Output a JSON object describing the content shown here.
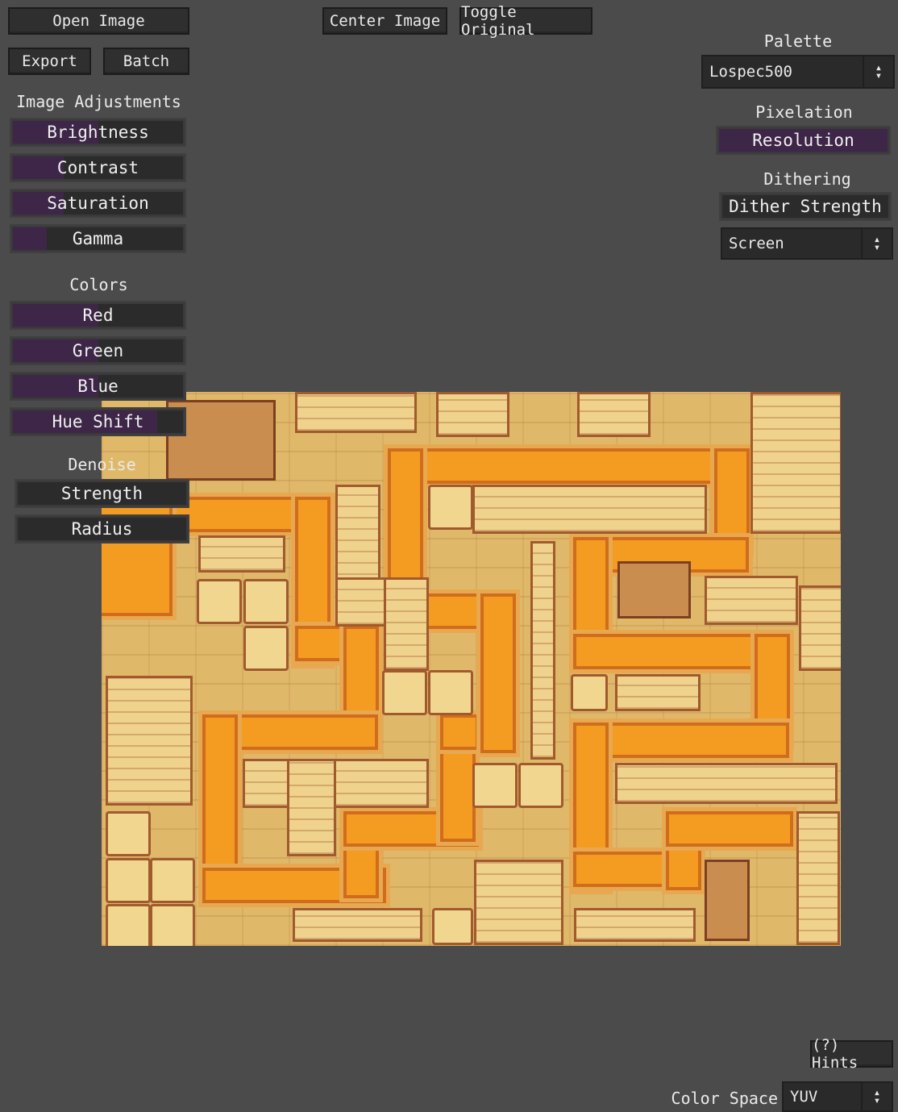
{
  "toolbar": {
    "open_image": "Open Image",
    "export": "Export",
    "batch": "Batch",
    "center_image": "Center Image",
    "toggle_original": "Toggle Original"
  },
  "adjustments": {
    "heading": "Image Adjustments",
    "brightness": {
      "label": "Brightness",
      "value": 0.5
    },
    "contrast": {
      "label": "Contrast",
      "value": 0.3
    },
    "saturation": {
      "label": "Saturation",
      "value": 0.3
    },
    "gamma": {
      "label": "Gamma",
      "value": 0.2
    }
  },
  "colors": {
    "heading": "Colors",
    "red": {
      "label": "Red",
      "value": 0.5
    },
    "green": {
      "label": "Green",
      "value": 0.5
    },
    "blue": {
      "label": "Blue",
      "value": 0.5
    },
    "hue_shift": {
      "label": "Hue Shift",
      "value": 0.85
    }
  },
  "denoise": {
    "heading": "Denoise",
    "strength": {
      "label": "Strength",
      "value": 0.0
    },
    "radius": {
      "label": "Radius",
      "value": 0.0
    }
  },
  "palette": {
    "heading": "Palette",
    "selected": "Lospec500"
  },
  "pixelation": {
    "heading": "Pixelation",
    "resolution": {
      "label": "Resolution",
      "value": 1.0
    }
  },
  "dithering": {
    "heading": "Dithering",
    "strength": {
      "label": "Dither Strength",
      "value": 0.0
    },
    "mode": "Screen"
  },
  "hints": "(?) Hints",
  "color_space": {
    "label": "Color Space",
    "selected": "YUV"
  },
  "colors_theme": {
    "background": "#4b4b4b",
    "slider_fill": "#3d2647",
    "button": "#2f2f2f",
    "path_orange": "#f49c22",
    "floor": "#e0b86a"
  }
}
